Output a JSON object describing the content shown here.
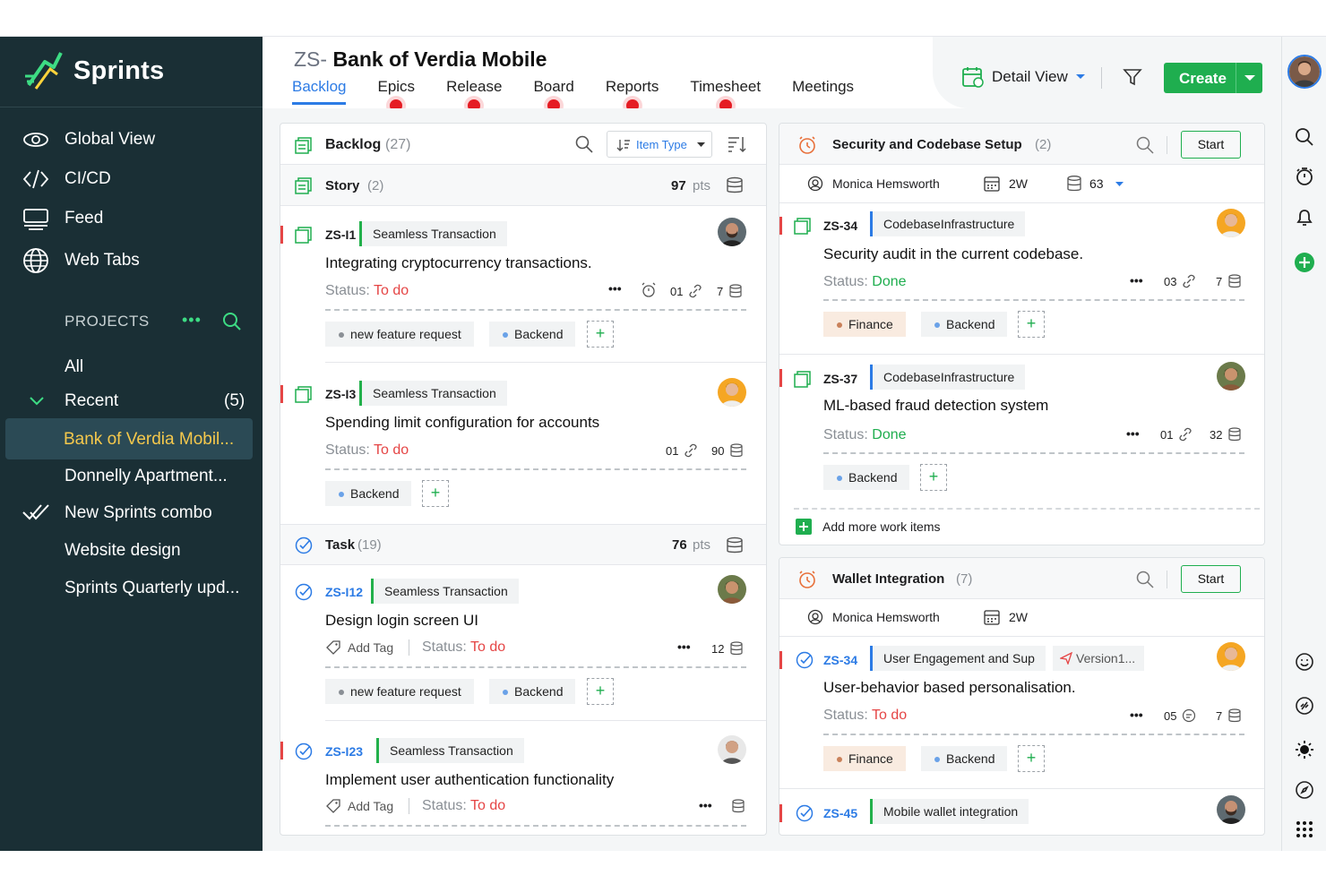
{
  "app": {
    "name": "Sprints"
  },
  "sidebar": {
    "nav": [
      {
        "label": "Global View",
        "icon": "eye-icon"
      },
      {
        "label": "CI/CD",
        "icon": "code-icon"
      },
      {
        "label": "Feed",
        "icon": "feed-icon"
      },
      {
        "label": "Web Tabs",
        "icon": "globe-icon"
      }
    ],
    "projects_heading": "PROJECTS",
    "projects": {
      "all": "All",
      "recent": "Recent",
      "recent_count": "(5)",
      "items": [
        "Bank of Verdia Mobil...",
        "Donnelly Apartment...",
        "New Sprints combo",
        "Website design",
        "Sprints Quarterly upd..."
      ]
    }
  },
  "header": {
    "prefix": "ZS-",
    "project": "Bank of Verdia Mobile",
    "tabs": [
      "Backlog",
      "Epics",
      "Release",
      "Board",
      "Reports",
      "Timesheet",
      "Meetings"
    ],
    "active_tab": "Backlog",
    "view": "Detail View",
    "create": "Create"
  },
  "backlog": {
    "title": "Backlog",
    "count": "(27)",
    "item_type": "Item Type",
    "story": {
      "label": "Story",
      "count": "(2)",
      "pts": "97",
      "pts_label": "pts"
    },
    "task": {
      "label": "Task",
      "count": "(19)",
      "pts": "76",
      "pts_label": "pts"
    },
    "items": [
      {
        "id": "ZS-I1",
        "epic": "Seamless Transaction",
        "title": "Integrating cryptocurrency transactions.",
        "status_label": "Status:",
        "status": "To do",
        "links": "01",
        "points": "7",
        "tags": [
          "new feature request",
          "Backend"
        ]
      },
      {
        "id": "ZS-I3",
        "epic": "Seamless Transaction",
        "title": "Spending limit configuration for accounts",
        "status_label": "Status:",
        "status": "To do",
        "links": "01",
        "points": "90",
        "tags": [
          "Backend"
        ]
      },
      {
        "id": "ZS-I12",
        "epic": "Seamless Transaction",
        "title": "Design login screen UI",
        "add_tag": "Add Tag",
        "status_label": "Status:",
        "status": "To do",
        "points": "12",
        "tags": [
          "new feature request",
          "Backend"
        ]
      },
      {
        "id": "ZS-I23",
        "epic": "Seamless Transaction",
        "title": "Implement user authentication functionality",
        "add_tag": "Add Tag",
        "status_label": "Status:",
        "status": "To do"
      }
    ]
  },
  "sprints": [
    {
      "name": "Security and Codebase Setup",
      "count": "(2)",
      "start": "Start",
      "owner": "Monica Hemsworth",
      "duration": "2W",
      "points": "63",
      "items": [
        {
          "id": "ZS-34",
          "epic": "CodebaseInfrastructure",
          "title": "Security audit in the current codebase.",
          "status_label": "Status:",
          "status": "Done",
          "links": "03",
          "points": "7",
          "tags": [
            "Finance",
            "Backend"
          ]
        },
        {
          "id": "ZS-37",
          "epic": "CodebaseInfrastructure",
          "title": "ML-based fraud detection system",
          "status_label": "Status:",
          "status": "Done",
          "links": "01",
          "points": "32",
          "tags": [
            "Backend"
          ]
        }
      ],
      "add_more": "Add more work items"
    },
    {
      "name": "Wallet Integration",
      "count": "(7)",
      "start": "Start",
      "owner": "Monica Hemsworth",
      "duration": "2W",
      "items": [
        {
          "id": "ZS-34",
          "epic": "User Engagement and Sup",
          "release": "Version1...",
          "title": "User-behavior based personalisation.",
          "status_label": "Status:",
          "status": "To do",
          "comments": "05",
          "points": "7",
          "tags": [
            "Finance",
            "Backend"
          ]
        },
        {
          "id": "ZS-45",
          "epic": "Mobile wallet integration"
        }
      ]
    }
  ],
  "colors": {
    "sidebar": "#1a2f35",
    "accent": "#2c7be5",
    "green": "#1fae4f",
    "red": "#e54545"
  }
}
